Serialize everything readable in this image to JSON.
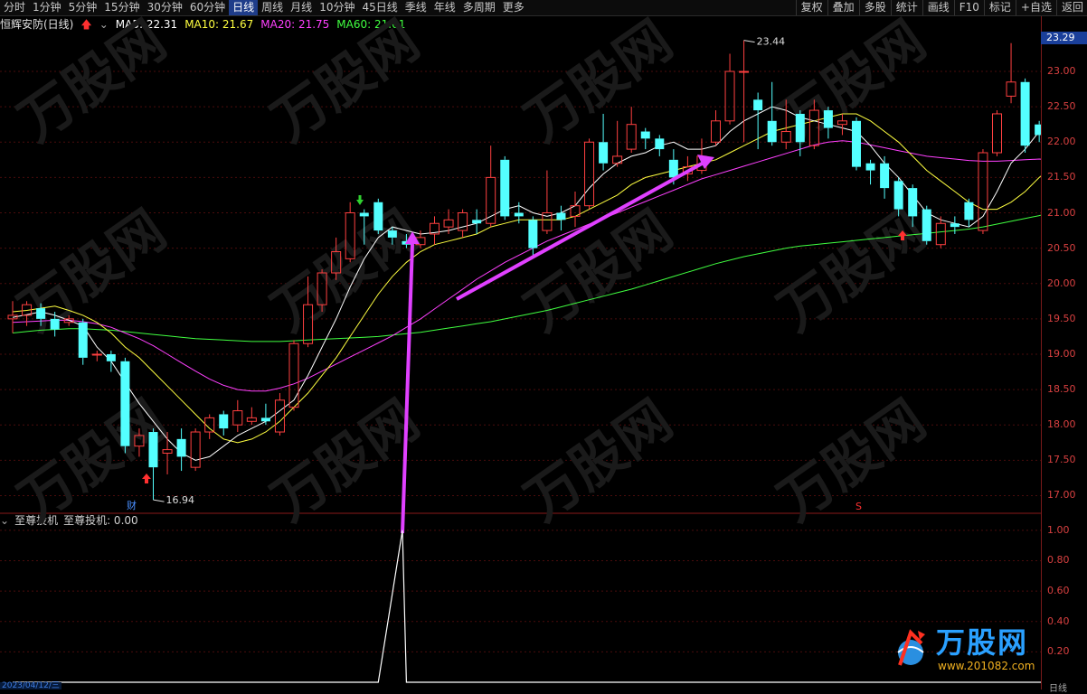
{
  "toolbar": {
    "periods": [
      "分时",
      "1分钟",
      "5分钟",
      "15分钟",
      "30分钟",
      "60分钟",
      "日线",
      "周线",
      "月线",
      "10分钟",
      "45日线",
      "季线",
      "年线",
      "多周期",
      "更多"
    ],
    "active_index": 6,
    "right_items": [
      "复权",
      "叠加",
      "多股",
      "统计",
      "画线",
      "F10",
      "标记",
      "+自选",
      "返回"
    ]
  },
  "legend": {
    "stock": "恒辉安防(日线)",
    "ma5": "MA5: 22.31",
    "ma10": "MA10: 21.67",
    "ma20": "MA20: 21.75",
    "ma60": "MA60: 21.01"
  },
  "indicator": {
    "name": "至尊投机",
    "value": "至尊投机: 0.00"
  },
  "price_box": "23.29",
  "axis": {
    "price_ticks": [
      "23.00",
      "22.50",
      "22.00",
      "21.50",
      "21.00",
      "20.50",
      "20.00",
      "19.50",
      "19.00",
      "18.50",
      "18.00",
      "17.50",
      "17.00"
    ],
    "indicator_ticks": [
      "1.00",
      "0.80",
      "0.60",
      "0.40",
      "0.20"
    ]
  },
  "annotations": {
    "high_label": "23.44",
    "low_label": "16.94",
    "cai_marker": "财",
    "s_marker": "S"
  },
  "colors": {
    "up": "#ff4040",
    "down": "#54ffff",
    "ma5": "#ffffff",
    "ma10": "#ffff40",
    "ma20": "#ff40ff",
    "ma60": "#40ff40",
    "arrow": "#e040ff"
  },
  "watermark": {
    "brand": "万股网",
    "url": "www.201082.com"
  },
  "date_label": "2023/04/12/三",
  "bottom_right": "日线",
  "chart_data": {
    "type": "candlestick",
    "ylim": [
      16.75,
      23.55
    ],
    "candles": [
      {
        "o": 19.5,
        "c": 19.55,
        "h": 19.75,
        "l": 19.3
      },
      {
        "o": 19.55,
        "c": 19.7,
        "h": 19.75,
        "l": 19.4
      },
      {
        "o": 19.65,
        "c": 19.5,
        "h": 19.72,
        "l": 19.4
      },
      {
        "o": 19.5,
        "c": 19.35,
        "h": 19.6,
        "l": 19.25
      },
      {
        "o": 19.45,
        "c": 19.5,
        "h": 19.55,
        "l": 19.4
      },
      {
        "o": 19.45,
        "c": 18.95,
        "h": 19.5,
        "l": 18.85
      },
      {
        "o": 19.0,
        "c": 19.0,
        "h": 19.05,
        "l": 18.9
      },
      {
        "o": 19.0,
        "c": 18.9,
        "h": 19.05,
        "l": 18.75
      },
      {
        "o": 18.9,
        "c": 17.7,
        "h": 18.95,
        "l": 17.6
      },
      {
        "o": 17.7,
        "c": 17.85,
        "h": 17.95,
        "l": 17.55
      },
      {
        "o": 17.9,
        "c": 17.4,
        "h": 17.95,
        "l": 16.94
      },
      {
        "o": 17.6,
        "c": 17.65,
        "h": 17.9,
        "l": 17.3
      },
      {
        "o": 17.8,
        "c": 17.55,
        "h": 17.95,
        "l": 17.35
      },
      {
        "o": 17.4,
        "c": 17.9,
        "h": 17.95,
        "l": 17.35
      },
      {
        "o": 17.9,
        "c": 18.1,
        "h": 18.15,
        "l": 17.8
      },
      {
        "o": 18.15,
        "c": 17.95,
        "h": 18.2,
        "l": 17.85
      },
      {
        "o": 18.0,
        "c": 18.2,
        "h": 18.35,
        "l": 17.9
      },
      {
        "o": 18.05,
        "c": 18.1,
        "h": 18.25,
        "l": 18.0
      },
      {
        "o": 18.1,
        "c": 18.05,
        "h": 18.3,
        "l": 18.0
      },
      {
        "o": 17.9,
        "c": 18.35,
        "h": 18.45,
        "l": 17.85
      },
      {
        "o": 18.25,
        "c": 19.15,
        "h": 19.2,
        "l": 18.2
      },
      {
        "o": 19.15,
        "c": 19.7,
        "h": 20.1,
        "l": 19.1
      },
      {
        "o": 19.7,
        "c": 20.15,
        "h": 20.2,
        "l": 19.6
      },
      {
        "o": 20.15,
        "c": 20.45,
        "h": 20.65,
        "l": 20.05
      },
      {
        "o": 20.35,
        "c": 21.0,
        "h": 21.15,
        "l": 20.3
      },
      {
        "o": 21.0,
        "c": 20.95,
        "h": 21.05,
        "l": 20.55
      },
      {
        "o": 21.15,
        "c": 20.75,
        "h": 21.2,
        "l": 20.7
      },
      {
        "o": 20.75,
        "c": 20.65,
        "h": 20.8,
        "l": 20.55
      },
      {
        "o": 20.6,
        "c": 20.55,
        "h": 20.7,
        "l": 20.5
      },
      {
        "o": 20.55,
        "c": 20.65,
        "h": 20.75,
        "l": 20.5
      },
      {
        "o": 20.7,
        "c": 20.85,
        "h": 20.95,
        "l": 20.55
      },
      {
        "o": 20.8,
        "c": 20.9,
        "h": 21.05,
        "l": 20.7
      },
      {
        "o": 20.75,
        "c": 21.0,
        "h": 21.05,
        "l": 20.65
      },
      {
        "o": 20.9,
        "c": 20.85,
        "h": 21.05,
        "l": 20.7
      },
      {
        "o": 20.85,
        "c": 21.5,
        "h": 21.95,
        "l": 20.8
      },
      {
        "o": 21.75,
        "c": 20.95,
        "h": 21.8,
        "l": 20.9
      },
      {
        "o": 21.0,
        "c": 20.95,
        "h": 21.15,
        "l": 20.85
      },
      {
        "o": 20.9,
        "c": 20.5,
        "h": 20.95,
        "l": 20.4
      },
      {
        "o": 20.75,
        "c": 21.0,
        "h": 21.6,
        "l": 20.7
      },
      {
        "o": 21.0,
        "c": 20.9,
        "h": 21.1,
        "l": 20.75
      },
      {
        "o": 20.95,
        "c": 21.1,
        "h": 21.3,
        "l": 20.8
      },
      {
        "o": 21.1,
        "c": 22.0,
        "h": 22.05,
        "l": 21.05
      },
      {
        "o": 22.0,
        "c": 21.7,
        "h": 22.4,
        "l": 21.6
      },
      {
        "o": 21.7,
        "c": 21.8,
        "h": 22.3,
        "l": 21.65
      },
      {
        "o": 21.9,
        "c": 22.25,
        "h": 22.5,
        "l": 21.85
      },
      {
        "o": 22.15,
        "c": 22.05,
        "h": 22.2,
        "l": 21.9
      },
      {
        "o": 22.05,
        "c": 21.9,
        "h": 22.1,
        "l": 21.8
      },
      {
        "o": 21.75,
        "c": 21.5,
        "h": 21.9,
        "l": 21.4
      },
      {
        "o": 21.55,
        "c": 21.65,
        "h": 21.8,
        "l": 21.45
      },
      {
        "o": 21.6,
        "c": 21.8,
        "h": 22.05,
        "l": 21.55
      },
      {
        "o": 22.0,
        "c": 22.3,
        "h": 22.45,
        "l": 21.95
      },
      {
        "o": 22.3,
        "c": 23.0,
        "h": 23.25,
        "l": 22.25
      },
      {
        "o": 23.0,
        "c": 23.0,
        "h": 23.44,
        "l": 22.0
      },
      {
        "o": 22.6,
        "c": 22.45,
        "h": 22.7,
        "l": 21.9
      },
      {
        "o": 22.3,
        "c": 22.0,
        "h": 22.85,
        "l": 21.95
      },
      {
        "o": 22.0,
        "c": 22.15,
        "h": 22.6,
        "l": 21.9
      },
      {
        "o": 22.4,
        "c": 22.0,
        "h": 22.45,
        "l": 21.8
      },
      {
        "o": 21.95,
        "c": 22.45,
        "h": 22.6,
        "l": 21.9
      },
      {
        "o": 22.45,
        "c": 22.2,
        "h": 22.5,
        "l": 22.05
      },
      {
        "o": 22.25,
        "c": 22.3,
        "h": 22.4,
        "l": 22.1
      },
      {
        "o": 22.3,
        "c": 21.65,
        "h": 22.35,
        "l": 21.6
      },
      {
        "o": 21.7,
        "c": 21.6,
        "h": 21.75,
        "l": 21.4
      },
      {
        "o": 21.7,
        "c": 21.35,
        "h": 21.8,
        "l": 21.2
      },
      {
        "o": 21.45,
        "c": 21.05,
        "h": 21.5,
        "l": 20.95
      },
      {
        "o": 21.35,
        "c": 20.95,
        "h": 21.4,
        "l": 20.8
      },
      {
        "o": 21.05,
        "c": 20.6,
        "h": 21.1,
        "l": 20.55
      },
      {
        "o": 20.55,
        "c": 20.85,
        "h": 20.95,
        "l": 20.5
      },
      {
        "o": 20.85,
        "c": 20.8,
        "h": 20.95,
        "l": 20.7
      },
      {
        "o": 21.15,
        "c": 20.9,
        "h": 21.2,
        "l": 20.8
      },
      {
        "o": 20.75,
        "c": 21.85,
        "h": 21.9,
        "l": 20.7
      },
      {
        "o": 21.85,
        "c": 22.4,
        "h": 22.45,
        "l": 21.8
      },
      {
        "o": 22.65,
        "c": 22.85,
        "h": 23.4,
        "l": 22.55
      },
      {
        "o": 22.85,
        "c": 21.95,
        "h": 22.9,
        "l": 21.85
      },
      {
        "o": 22.25,
        "c": 22.1,
        "h": 22.3,
        "l": 22.0
      },
      {
        "o": 22.0,
        "c": 22.1,
        "h": 22.35,
        "l": 21.95
      }
    ],
    "ma5": [
      19.52,
      19.56,
      19.6,
      19.55,
      19.48,
      19.4,
      19.1,
      18.9,
      18.6,
      18.3,
      18.05,
      17.8,
      17.6,
      17.5,
      17.55,
      17.7,
      17.85,
      17.95,
      18.05,
      18.2,
      18.35,
      18.7,
      19.1,
      19.5,
      19.95,
      20.35,
      20.65,
      20.8,
      20.75,
      20.7,
      20.72,
      20.75,
      20.8,
      20.85,
      20.95,
      21.05,
      21.1,
      21.0,
      20.95,
      21.0,
      21.1,
      21.35,
      21.55,
      21.7,
      21.8,
      21.85,
      21.95,
      22.0,
      21.9,
      21.9,
      21.95,
      22.15,
      22.3,
      22.4,
      22.5,
      22.45,
      22.35,
      22.3,
      22.25,
      22.2,
      22.15,
      21.95,
      21.7,
      21.5,
      21.25,
      21.0,
      20.9,
      20.85,
      20.8,
      20.95,
      21.3,
      21.7,
      21.9,
      22.15,
      22.31
    ],
    "ma10": [
      19.6,
      19.62,
      19.65,
      19.68,
      19.62,
      19.55,
      19.45,
      19.3,
      19.1,
      18.95,
      18.75,
      18.55,
      18.35,
      18.15,
      17.95,
      17.8,
      17.75,
      17.8,
      17.9,
      18.05,
      18.25,
      18.45,
      18.7,
      18.95,
      19.25,
      19.55,
      19.85,
      20.1,
      20.3,
      20.45,
      20.55,
      20.6,
      20.65,
      20.7,
      20.8,
      20.85,
      20.9,
      20.9,
      20.9,
      20.9,
      20.95,
      21.05,
      21.15,
      21.25,
      21.4,
      21.5,
      21.55,
      21.6,
      21.65,
      21.7,
      21.75,
      21.85,
      21.95,
      22.05,
      22.15,
      22.2,
      22.25,
      22.3,
      22.35,
      22.4,
      22.4,
      22.3,
      22.15,
      22.0,
      21.8,
      21.6,
      21.45,
      21.3,
      21.15,
      21.05,
      21.05,
      21.15,
      21.3,
      21.5,
      21.67
    ],
    "ma20": [
      19.45,
      19.46,
      19.47,
      19.48,
      19.48,
      19.46,
      19.43,
      19.38,
      19.3,
      19.22,
      19.12,
      19.0,
      18.88,
      18.76,
      18.65,
      18.56,
      18.5,
      18.48,
      18.48,
      18.52,
      18.58,
      18.66,
      18.76,
      18.86,
      18.96,
      19.06,
      19.16,
      19.26,
      19.38,
      19.5,
      19.64,
      19.78,
      19.92,
      20.06,
      20.18,
      20.3,
      20.4,
      20.5,
      20.6,
      20.68,
      20.76,
      20.84,
      20.92,
      21.0,
      21.08,
      21.16,
      21.24,
      21.32,
      21.4,
      21.48,
      21.54,
      21.6,
      21.66,
      21.72,
      21.78,
      21.84,
      21.9,
      21.96,
      22.0,
      22.02,
      22.0,
      21.96,
      21.92,
      21.88,
      21.84,
      21.8,
      21.78,
      21.76,
      21.74,
      21.73,
      21.73,
      21.74,
      21.75,
      21.76,
      21.75
    ],
    "ma60": [
      19.3,
      19.32,
      19.34,
      19.35,
      19.36,
      19.36,
      19.35,
      19.34,
      19.32,
      19.3,
      19.28,
      19.26,
      19.24,
      19.22,
      19.21,
      19.2,
      19.19,
      19.18,
      19.18,
      19.18,
      19.19,
      19.2,
      19.21,
      19.22,
      19.23,
      19.24,
      19.25,
      19.27,
      19.29,
      19.31,
      19.34,
      19.37,
      19.4,
      19.43,
      19.46,
      19.5,
      19.54,
      19.58,
      19.62,
      19.67,
      19.72,
      19.77,
      19.82,
      19.87,
      19.92,
      19.98,
      20.04,
      20.1,
      20.16,
      20.22,
      20.28,
      20.33,
      20.38,
      20.42,
      20.46,
      20.5,
      20.53,
      20.55,
      20.57,
      20.59,
      20.61,
      20.63,
      20.65,
      20.67,
      20.69,
      20.71,
      20.73,
      20.75,
      20.77,
      20.8,
      20.84,
      20.88,
      20.92,
      20.96,
      21.01
    ],
    "indicator_values": [
      0,
      0,
      0,
      0,
      0,
      0,
      0,
      0,
      0,
      0,
      0,
      0,
      0,
      0,
      0,
      0,
      0,
      0,
      0,
      0,
      0,
      0,
      0,
      0,
      0,
      0,
      0,
      1,
      0,
      0,
      0,
      0,
      0,
      0,
      0,
      0,
      0,
      0,
      0,
      0,
      0,
      0,
      0,
      0,
      0,
      0,
      0,
      0,
      0,
      0,
      0,
      0,
      0,
      0,
      0,
      0,
      0,
      0,
      0,
      0,
      0,
      0,
      0,
      0,
      0,
      0,
      0,
      0,
      0,
      0,
      0,
      0,
      0,
      0,
      0
    ],
    "indicator_ylim": [
      0,
      1.1
    ]
  }
}
